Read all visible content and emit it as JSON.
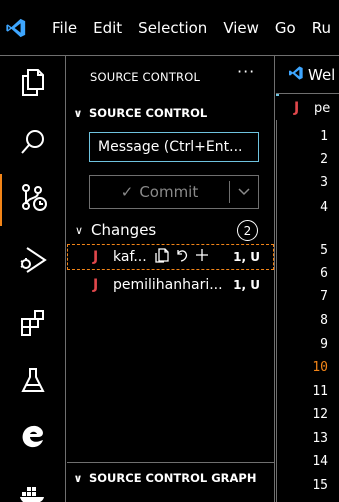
{
  "menubar": {
    "logo_icon": "vscode-logo-icon",
    "items": [
      "File",
      "Edit",
      "Selection",
      "View",
      "Go",
      "Ru"
    ]
  },
  "activitybar": {
    "items": [
      {
        "name": "explorer",
        "icon": "files-icon"
      },
      {
        "name": "search",
        "icon": "search-icon"
      },
      {
        "name": "source-control",
        "icon": "source-control-icon",
        "active": true
      },
      {
        "name": "run-debug",
        "icon": "run-debug-icon"
      },
      {
        "name": "extensions",
        "icon": "extensions-icon"
      },
      {
        "name": "testing",
        "icon": "flask-icon"
      },
      {
        "name": "edge-devtools",
        "icon": "edge-icon"
      },
      {
        "name": "docker",
        "icon": "docker-icon"
      }
    ]
  },
  "sidebar": {
    "title": "SOURCE CONTROL",
    "more": "···",
    "section_label": "SOURCE CONTROL",
    "message_placeholder": "Message (Ctrl+Ent...",
    "commit_label": "Commit",
    "changes_label": "Changes",
    "changes_count": "2",
    "files": [
      {
        "name": "kaf...",
        "status": "1, U",
        "focused": true
      },
      {
        "name": "pemilihanhari...",
        "status": "1, U",
        "focused": false
      }
    ],
    "graph_label": "SOURCE CONTROL GRAPH"
  },
  "editor": {
    "tab_label": "Wel",
    "breadcrumb": "pe",
    "line_numbers": [
      "1",
      "2",
      "3",
      "4",
      "5",
      "6",
      "7",
      "8",
      "9",
      "10",
      "11",
      "12",
      "13",
      "14",
      "15"
    ],
    "current_line": "10"
  },
  "colors": {
    "accent_blue": "#6fc3df",
    "active_orange": "#f38518",
    "java_red": "#e0474b",
    "border": "#6f6f6f"
  }
}
